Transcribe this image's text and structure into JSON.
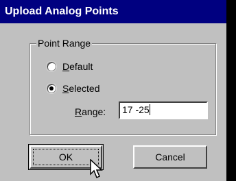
{
  "dialog": {
    "title": "Upload Analog Points",
    "group_label": "Point Range",
    "options": [
      {
        "label_prefix": "",
        "mnemonic": "D",
        "label_rest": "efault",
        "checked": false
      },
      {
        "label_prefix": "",
        "mnemonic": "S",
        "label_rest": "elected",
        "checked": true
      }
    ],
    "range": {
      "mnemonic": "R",
      "label_rest": "ange:",
      "value": "17 -25"
    },
    "ok_label": "OK",
    "cancel_label": "Cancel"
  },
  "colors": {
    "title_bar": "#000080",
    "face": "#c0c0c0",
    "background": "#000000"
  },
  "icons": {
    "cursor": "arrow-pointer-icon"
  }
}
